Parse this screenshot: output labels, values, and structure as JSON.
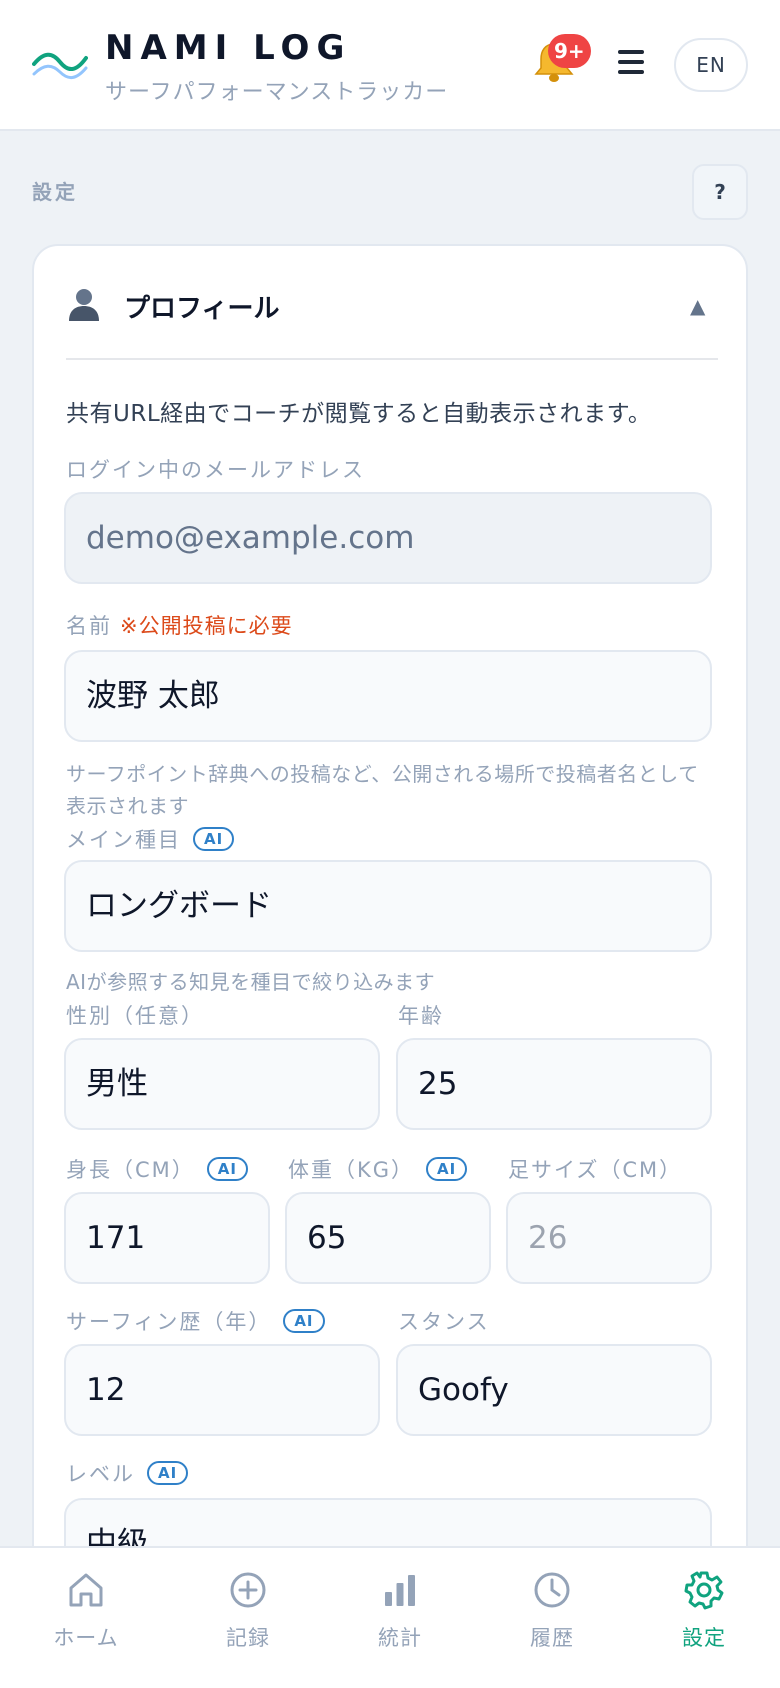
{
  "header": {
    "brand": "NAMI LOG",
    "subtitle": "サーフパフォーマンストラッカー",
    "notification_badge": "9+",
    "lang_button": "EN"
  },
  "page": {
    "section_label": "設定",
    "help_button": "?"
  },
  "profile": {
    "title": "プロフィール",
    "intro": "共有URL経由でコーチが閲覧すると自動表示されます。",
    "email_label": "ログイン中のメールアドレス",
    "email_value": "demo@example.com",
    "name_label": "名前",
    "name_required": "※公開投稿に必要",
    "name_value": "波野 太郎",
    "name_hint": "サーフポイント辞典への投稿など、公開される場所で投稿者名として表示されます",
    "main_event_label": "メイン種目",
    "main_event_value": "ロングボード",
    "main_event_hint": "AIが参照する知見を種目で絞り込みます",
    "gender_label": "性別（任意）",
    "gender_value": "男性",
    "age_label": "年齢",
    "age_value": "25",
    "height_label": "身長（CM）",
    "height_value": "171",
    "weight_label": "体重（KG）",
    "weight_value": "65",
    "foot_label": "足サイズ（CM）",
    "foot_placeholder": "26",
    "surf_years_label": "サーフィン歴（年）",
    "surf_years_value": "12",
    "stance_label": "スタンス",
    "stance_value": "Goofy",
    "level_label": "レベル",
    "level_value": "中級",
    "ai_tag": "AI"
  },
  "nav": {
    "items": [
      {
        "label": "ホーム",
        "icon": "home-icon"
      },
      {
        "label": "記録",
        "icon": "plus-circle-icon"
      },
      {
        "label": "統計",
        "icon": "bar-chart-icon"
      },
      {
        "label": "履歴",
        "icon": "clock-icon"
      },
      {
        "label": "設定",
        "icon": "gear-icon"
      }
    ],
    "active_index": 4,
    "active_color": "#10a37f",
    "inactive_color": "#94a3b8"
  }
}
